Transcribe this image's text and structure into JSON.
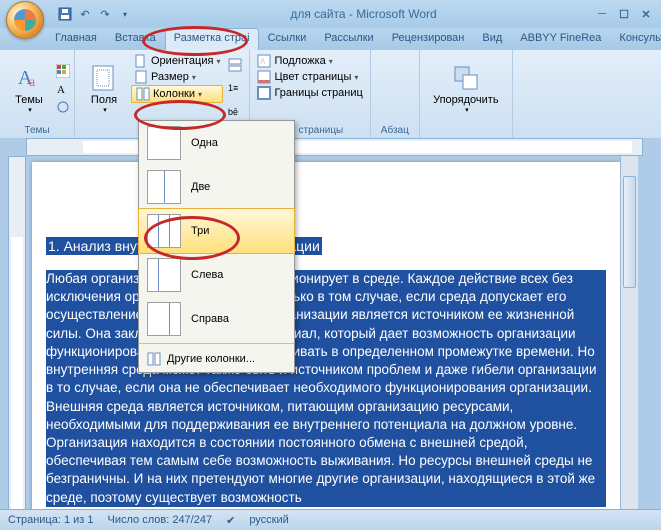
{
  "title": "для сайта - Microsoft Word",
  "tabs": {
    "home": "Главная",
    "insert": "Вставка",
    "layout": "Разметка страі",
    "refs": "Ссылки",
    "mail": "Рассылки",
    "review": "Рецензирован",
    "view": "Вид",
    "abbyy": "ABBYY FineRea",
    "consultant": "КонсультантП"
  },
  "groups": {
    "themes": "Темы",
    "themes_btn": "Темы",
    "page_setup": {
      "margins": "Поля",
      "orientation": "Ориентация",
      "size": "Размер",
      "columns": "Колонки"
    },
    "page_bg": {
      "watermark": "Подложка",
      "color": "Цвет страницы",
      "borders": "Границы страниц",
      "label": "Фон страницы"
    },
    "paragraph": {
      "label": "Абзац"
    },
    "arrange": {
      "btn": "Упорядочить"
    }
  },
  "columns_menu": {
    "one": "Одна",
    "two": "Две",
    "three": "Три",
    "left": "Слева",
    "right": "Справа",
    "more": "Другие колонки..."
  },
  "doc": {
    "heading": "1. Анализ внутренней среды организации",
    "body": "Любая организация находится и функционирует в среде. Каждое действие всех без исключения организаций возможно только в том случае, если среда допускает его осуществление. Внутренняя среда организации является источником ее жизненной силы. Она заключает   в себе тот потенциал, который дает возможность организации функционировать, существовать и выживать в определенном промежутке времени. Но внутренняя среда может также быть и источником проблем   и даже гибели организации в то случае, если она не обеспечивает необходимого функционирования  организации.\nВнешняя  среда является источником, питающим организацию ресурсами, необходимыми для поддерживания ее внутреннего потенциала на должном уровне. Организация находится в состоянии постоянного обмена с внешней средой, обеспечивая тем самым себе возможность выживания. Но ресурсы внешней среды не безграничны. И на них претендуют многие другие организации, находящиеся в этой же среде, поэтому существует возможность"
  },
  "status": {
    "page": "Страница: 1 из 1",
    "words": "Число слов: 247/247",
    "lang": "русский"
  }
}
